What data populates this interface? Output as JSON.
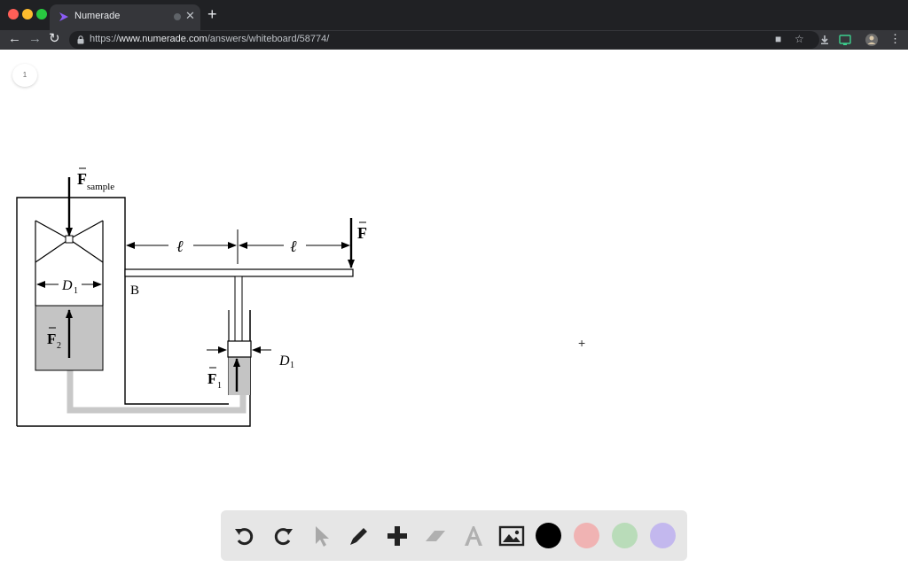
{
  "browser": {
    "tab_title": "Numerade",
    "url_scheme": "https://",
    "url_host": "www.numerade.com",
    "url_path": "/answers/whiteboard/58774/"
  },
  "page": {
    "page_number": "1"
  },
  "diagram": {
    "label_f_sample_main": "F",
    "label_f_sample_sub": "sample",
    "label_f": "F",
    "label_ell_left": "ℓ",
    "label_ell_right": "ℓ",
    "label_b": "B",
    "label_d1_left_main": "D",
    "label_d1_left_sub": "1",
    "label_d1_right_main": "D",
    "label_d1_right_sub": "1",
    "label_f2_main": "F",
    "label_f2_sub": "2",
    "label_f1_main": "F",
    "label_f1_sub": "1"
  },
  "toolbar": {
    "tools": [
      "undo-icon",
      "redo-icon",
      "pointer-icon",
      "pen-icon",
      "add-icon",
      "eraser-icon",
      "text-icon",
      "image-icon"
    ],
    "colors": [
      "#000000",
      "#f0b3b3",
      "#b9dcb9",
      "#c3b8ee"
    ]
  }
}
